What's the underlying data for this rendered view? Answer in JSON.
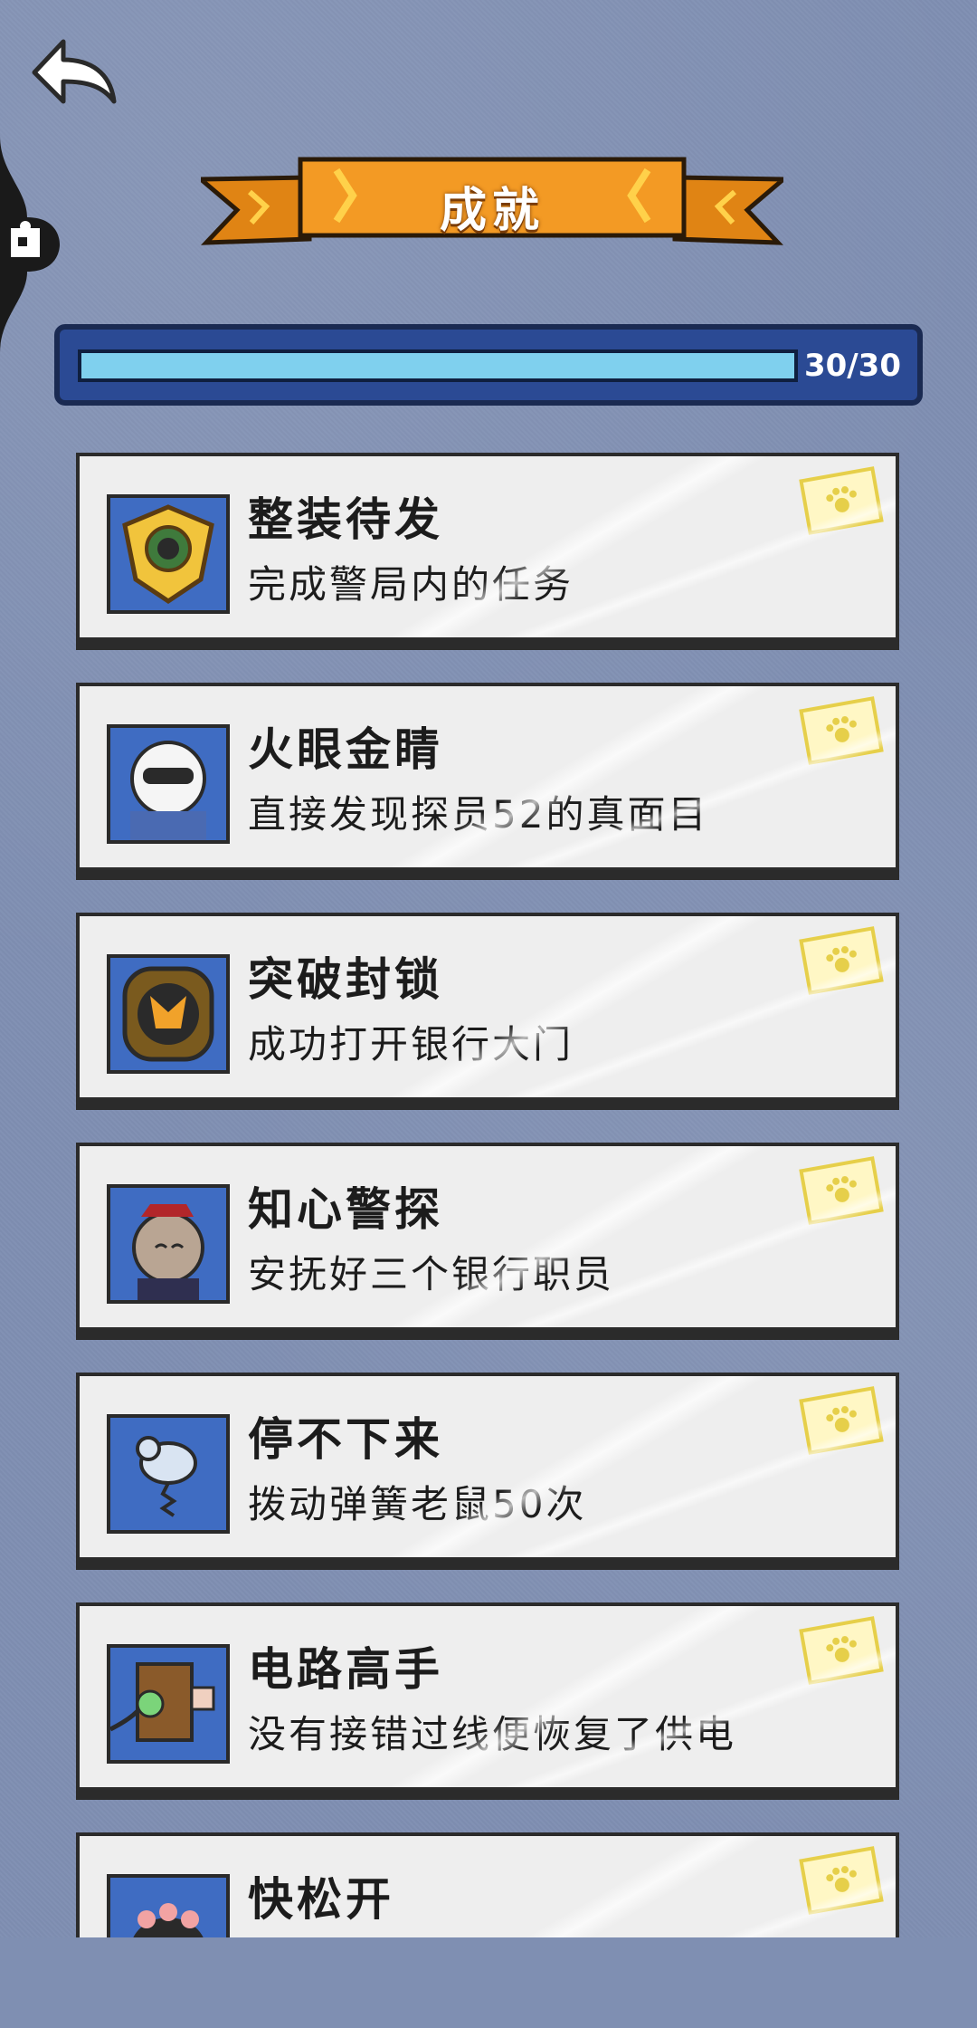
{
  "header": {
    "title": "成就",
    "progress_text": "30/30",
    "progress": 1.0
  },
  "achievements": [
    {
      "title": "整装待发",
      "desc": "完成警局内的任务",
      "icon": "police-badge-icon"
    },
    {
      "title": "火眼金睛",
      "desc": "直接发现探员52的真面目",
      "icon": "sunglasses-officer-icon"
    },
    {
      "title": "突破封锁",
      "desc": "成功打开银行大门",
      "icon": "bank-door-icon"
    },
    {
      "title": "知心警探",
      "desc": "安抚好三个银行职员",
      "icon": "cat-clerk-icon"
    },
    {
      "title": "停不下来",
      "desc": "拨动弹簧老鼠50次",
      "icon": "spring-mouse-icon"
    },
    {
      "title": "电路高手",
      "desc": "没有接错过线便恢复了供电",
      "icon": "power-box-icon"
    },
    {
      "title": "快松开",
      "desc": "",
      "icon": "cat-paw-icon"
    }
  ],
  "colors": {
    "background": "#7f8fb2",
    "ribbon": "#f39a24",
    "progress_fill": "#7fd0ee",
    "card": "#eeeeee",
    "reward_ticket": "#e6cf4a"
  }
}
